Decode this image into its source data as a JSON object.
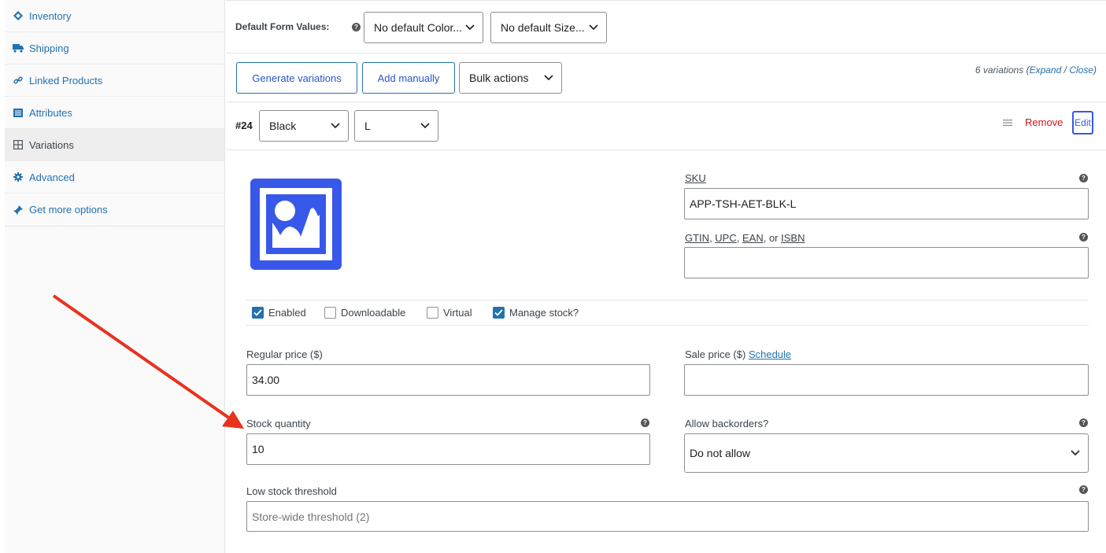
{
  "sidebar": {
    "items": [
      {
        "label": "Inventory",
        "icon": "inventory-icon"
      },
      {
        "label": "Shipping",
        "icon": "truck-icon"
      },
      {
        "label": "Linked Products",
        "icon": "link-icon"
      },
      {
        "label": "Attributes",
        "icon": "list-icon"
      },
      {
        "label": "Variations",
        "icon": "grid-icon"
      },
      {
        "label": "Advanced",
        "icon": "gear-icon"
      },
      {
        "label": "Get more options",
        "icon": "plugin-icon"
      }
    ],
    "active": "Variations"
  },
  "defaults": {
    "label": "Default Form Values:",
    "color_select": "No default Color...",
    "size_select": "No default Size..."
  },
  "actions": {
    "generate": "Generate variations",
    "add_manually": "Add manually",
    "bulk": "Bulk actions",
    "count_text": "6 variations",
    "expand": "Expand",
    "sep": "/",
    "close": "Close"
  },
  "variation": {
    "id": "#24",
    "color": "Black",
    "size": "L",
    "remove": "Remove",
    "edit": "Edit"
  },
  "fields": {
    "sku_label": "SKU",
    "sku_value": "APP-TSH-AET-BLK-L",
    "gtin_label_gtin": "GTIN",
    "gtin_label_upc": "UPC",
    "gtin_label_ean": "EAN",
    "gtin_label_or": ", or ",
    "gtin_label_isbn": "ISBN",
    "gtin_value": "",
    "enabled": "Enabled",
    "downloadable": "Downloadable",
    "virtual": "Virtual",
    "manage_stock": "Manage stock?",
    "regular_price_label": "Regular price ($)",
    "regular_price_value": "34.00",
    "sale_price_label": "Sale price ($)",
    "schedule": "Schedule",
    "sale_price_value": "",
    "stock_qty_label": "Stock quantity",
    "stock_qty_value": "10",
    "backorders_label": "Allow backorders?",
    "backorders_value": "Do not allow",
    "low_stock_label": "Low stock threshold",
    "low_stock_placeholder": "Store-wide threshold (2)"
  },
  "checkbox_states": {
    "enabled": true,
    "downloadable": false,
    "virtual": false,
    "manage_stock": true
  },
  "colors": {
    "accent": "#2271b1",
    "image_blue": "#3858e9",
    "remove_red": "#cc1818",
    "arrow_red": "#e8321f"
  }
}
